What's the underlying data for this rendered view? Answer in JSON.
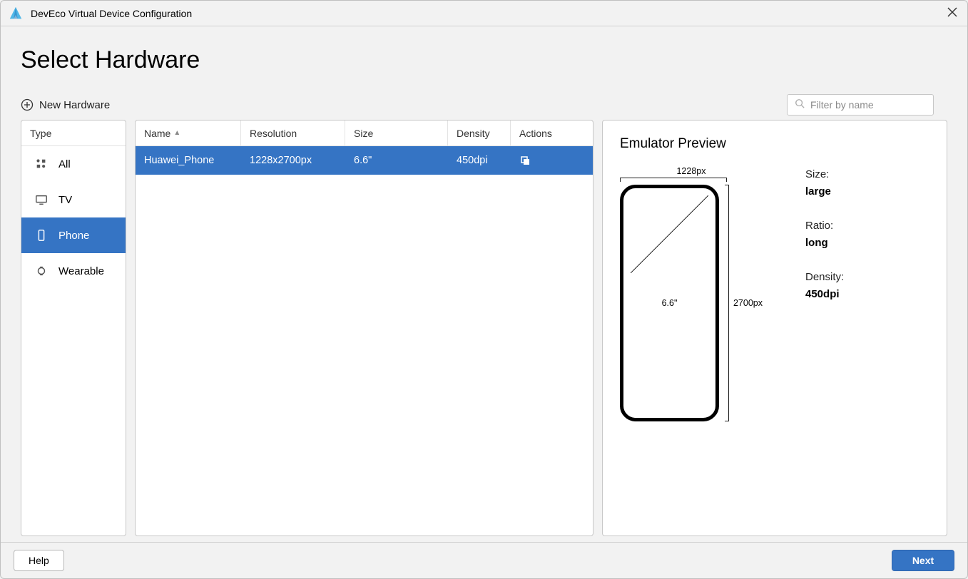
{
  "window": {
    "title": "DevEco Virtual Device Configuration"
  },
  "page": {
    "heading": "Select Hardware"
  },
  "toolbar": {
    "new_hardware": "New Hardware",
    "search_placeholder": "Filter by name"
  },
  "types": {
    "header": "Type",
    "items": [
      {
        "label": "All",
        "icon": "category-icon",
        "selected": false
      },
      {
        "label": "TV",
        "icon": "tv-icon",
        "selected": false
      },
      {
        "label": "Phone",
        "icon": "phone-icon",
        "selected": true
      },
      {
        "label": "Wearable",
        "icon": "watch-icon",
        "selected": false
      }
    ]
  },
  "devices": {
    "columns": [
      "Name",
      "Resolution",
      "Size",
      "Density",
      "Actions"
    ],
    "sort": {
      "column": "Name",
      "direction": "asc"
    },
    "rows": [
      {
        "name": "Huawei_Phone",
        "resolution": "1228x2700px",
        "size": "6.6\"",
        "density": "450dpi",
        "selected": true
      }
    ]
  },
  "preview": {
    "title": "Emulator Preview",
    "diagram": {
      "width_label": "1228px",
      "height_label": "2700px",
      "diagonal_label": "6.6\""
    },
    "props": [
      {
        "label": "Size:",
        "value": "large"
      },
      {
        "label": "Ratio:",
        "value": "long"
      },
      {
        "label": "Density:",
        "value": "450dpi"
      }
    ]
  },
  "footer": {
    "help": "Help",
    "next": "Next"
  },
  "colors": {
    "accent": "#3574c4"
  }
}
